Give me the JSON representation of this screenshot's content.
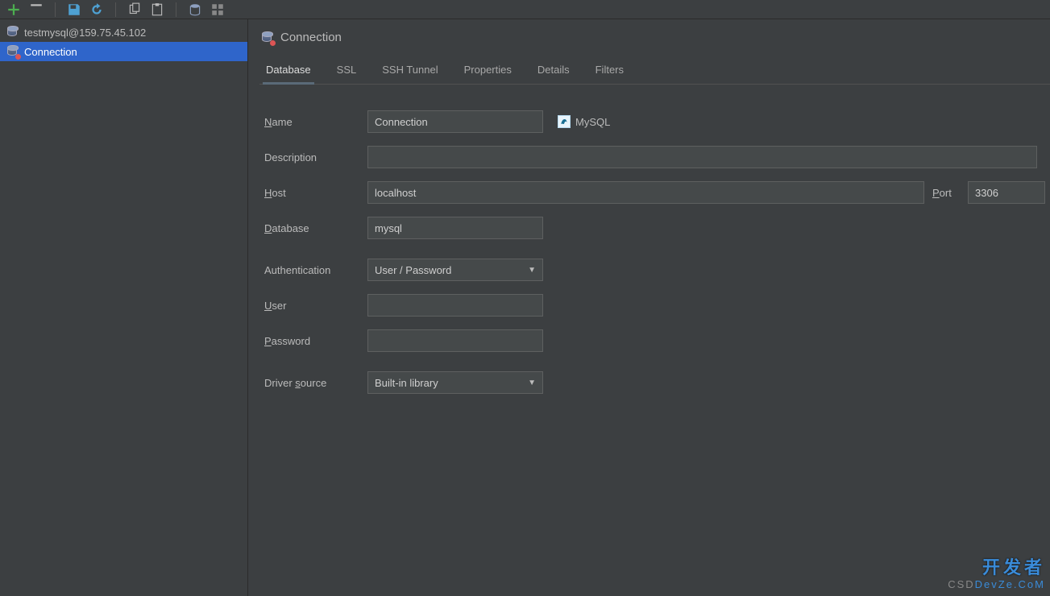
{
  "sidebar": {
    "items": [
      {
        "label": "testmysql@159.75.45.102"
      },
      {
        "label": "Connection"
      }
    ],
    "selectedIndex": 1
  },
  "header": {
    "title": "Connection"
  },
  "tabs": {
    "items": [
      {
        "label": "Database"
      },
      {
        "label": "SSL"
      },
      {
        "label": "SSH Tunnel"
      },
      {
        "label": "Properties"
      },
      {
        "label": "Details"
      },
      {
        "label": "Filters"
      }
    ],
    "activeIndex": 0
  },
  "form": {
    "name": {
      "label_pre": "N",
      "label_post": "ame",
      "value": "Connection"
    },
    "description": {
      "label": "Description",
      "value": ""
    },
    "host": {
      "label_pre": "H",
      "label_post": "ost",
      "value": "localhost"
    },
    "port": {
      "label_pre": "P",
      "label_post": "ort",
      "value": "3306"
    },
    "database": {
      "label_pre": "D",
      "label_post": "atabase",
      "value": "mysql"
    },
    "authentication": {
      "label": "Authentication",
      "value": "User / Password"
    },
    "user": {
      "label_pre": "U",
      "label_post": "ser",
      "value": ""
    },
    "password": {
      "label_pre": "P",
      "label_post": "assword",
      "value": ""
    },
    "driver_source": {
      "label_pre": "Driver ",
      "label_mid": "s",
      "label_post": "ource",
      "value": "Built-in library"
    },
    "dbtype": {
      "name": "MySQL"
    }
  },
  "watermark": {
    "line1": "开发者",
    "line2_a": "CSD",
    "line2_b": "DevZe.CoM"
  },
  "colors": {
    "selection": "#2f65ca",
    "bg": "#3c3f41",
    "input": "#45494a",
    "border": "#5e6060"
  }
}
